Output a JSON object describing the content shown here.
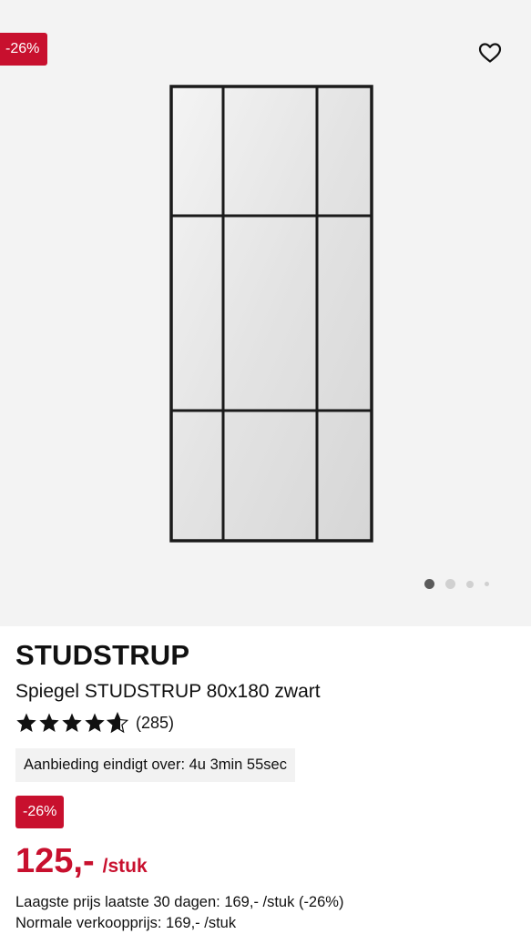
{
  "gallery": {
    "discount_badge": "-26%",
    "wishlist_icon": "heart-outline-icon",
    "image_alt": "mirror-product-image",
    "pagination": {
      "total": 4,
      "active": 1
    }
  },
  "product": {
    "brand": "STUDSTRUP",
    "name": "Spiegel STUDSTRUP 80x180 zwart",
    "rating": {
      "stars": 4.5,
      "count": "(285)"
    },
    "offer_timer": "Aanbieding eindigt over: 4u 3min 55sec",
    "discount_badge": "-26%",
    "price": "125,-",
    "unit": "/stuk",
    "lowest_price_note": "Laagste prijs laatste 30 dagen: 169,- /stuk (-26%)",
    "normal_price_note": "Normale verkoopprijs: 169,- /stuk"
  },
  "colors": {
    "accent_red": "#c8102e",
    "gallery_bg": "#f3f3f3",
    "offer_bg": "#f2f2f2"
  }
}
